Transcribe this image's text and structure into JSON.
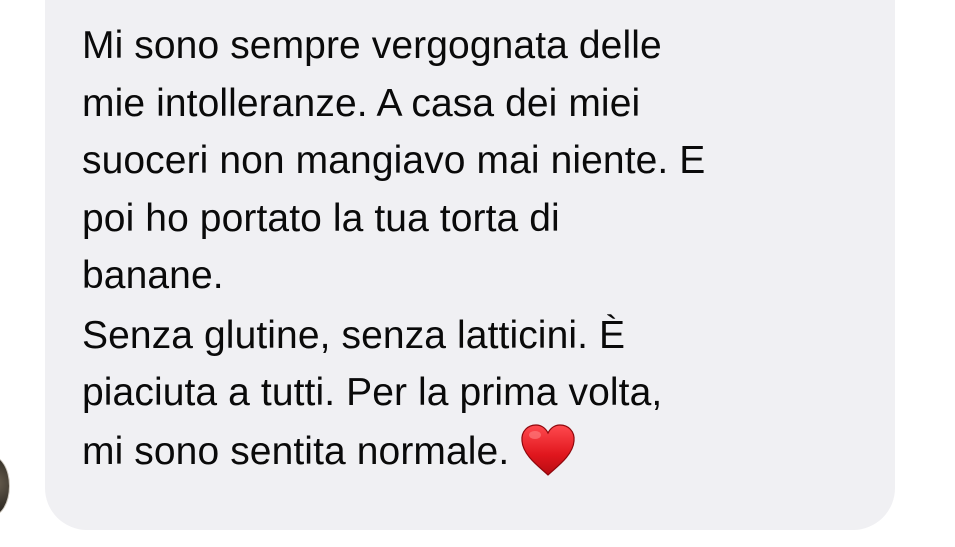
{
  "conversation": {
    "message": {
      "paragraph_1": [
        "Mi sono sempre vergognata delle",
        "mie intolleranze. A casa dei miei",
        "suoceri non mangiavo mai niente. E",
        "poi ho portato la tua torta di",
        "banane."
      ],
      "paragraph_2": [
        "Senza glutine, senza latticini. È",
        "piaciuta a tutti. Per la prima volta,",
        "mi sono sentita normale."
      ],
      "emoji": "red-heart-icon"
    }
  },
  "colors": {
    "bubble_background": "#f0f0f3",
    "text": "#0a0a0a",
    "heart": "#e0161d"
  }
}
